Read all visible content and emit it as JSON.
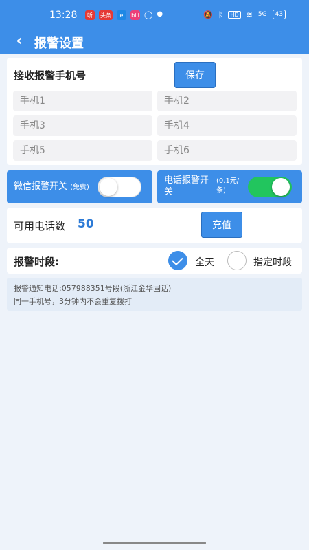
{
  "status_bar": {
    "time": "13:28",
    "apps": [
      {
        "icon": "listen-app-icon",
        "text": "听",
        "color": "#e53935"
      },
      {
        "icon": "toutiao-app-icon",
        "text": "头条",
        "color": "#e53935"
      },
      {
        "icon": "browser-app-icon",
        "text": "e",
        "color": "#1e88e5"
      },
      {
        "icon": "video-app-icon",
        "text": "bili",
        "color": "#ec407a"
      }
    ],
    "hd_label": "HD",
    "signal_label": "5G",
    "battery": "43"
  },
  "app_bar": {
    "back_glyph": "‹",
    "title": "报警设置"
  },
  "phone_section": {
    "title": "接收报警手机号",
    "save_label": "保存",
    "placeholders": [
      "手机1",
      "手机2",
      "手机3",
      "手机4",
      "手机5",
      "手机6"
    ]
  },
  "wechat_switch": {
    "label": "微信报警开关",
    "note": "(免费)",
    "state": "off"
  },
  "phone_switch": {
    "label": "电话报警开关",
    "note": "(0.1元/条)",
    "state": "on",
    "on_color": "#22c55e"
  },
  "credit": {
    "label": "可用电话数",
    "value": "50",
    "recharge_label": "充值"
  },
  "period": {
    "label": "报警时段:",
    "options": [
      {
        "label": "全天",
        "checked": true
      },
      {
        "label": "指定时段",
        "checked": false
      }
    ]
  },
  "notice": {
    "line1": "报警通知电话:057988351号段(浙江金华固话)",
    "line2": "同一手机号，3分钟内不会重复拨打"
  },
  "colors": {
    "accent": "#3d8ee8",
    "background": "#eef3fa"
  }
}
